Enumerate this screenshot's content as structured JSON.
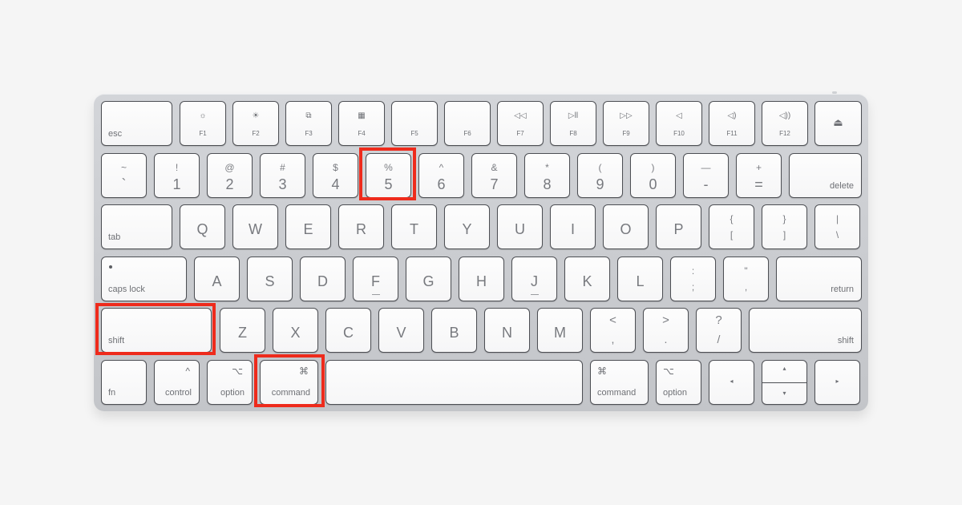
{
  "highlight_color": "#ee2b1c",
  "highlighted_keys": [
    "5",
    "shift-left",
    "command-left"
  ],
  "rows": {
    "function": {
      "esc": "esc",
      "f_keys": [
        {
          "label": "F1",
          "icon": "☼"
        },
        {
          "label": "F2",
          "icon": "☀"
        },
        {
          "label": "F3",
          "icon": "⧉"
        },
        {
          "label": "F4",
          "icon": "▦"
        },
        {
          "label": "F5",
          "icon": ""
        },
        {
          "label": "F6",
          "icon": ""
        },
        {
          "label": "F7",
          "icon": "◁◁"
        },
        {
          "label": "F8",
          "icon": "▷ll"
        },
        {
          "label": "F9",
          "icon": "▷▷"
        },
        {
          "label": "F10",
          "icon": "◁"
        },
        {
          "label": "F11",
          "icon": "◁)"
        },
        {
          "label": "F12",
          "icon": "◁))"
        }
      ],
      "eject_icon": "⏏"
    },
    "number": {
      "keys": [
        {
          "top": "~",
          "bottom": "`"
        },
        {
          "top": "!",
          "bottom": "1"
        },
        {
          "top": "@",
          "bottom": "2"
        },
        {
          "top": "#",
          "bottom": "3"
        },
        {
          "top": "$",
          "bottom": "4"
        },
        {
          "top": "%",
          "bottom": "5"
        },
        {
          "top": "^",
          "bottom": "6"
        },
        {
          "top": "&",
          "bottom": "7"
        },
        {
          "top": "*",
          "bottom": "8"
        },
        {
          "top": "(",
          "bottom": "9"
        },
        {
          "top": ")",
          "bottom": "0"
        },
        {
          "top": "—",
          "bottom": "-"
        },
        {
          "top": "+",
          "bottom": "="
        }
      ],
      "delete": "delete"
    },
    "qwerty": {
      "tab": "tab",
      "letters": [
        "Q",
        "W",
        "E",
        "R",
        "T",
        "Y",
        "U",
        "I",
        "O",
        "P"
      ],
      "brackets": [
        {
          "top": "{",
          "bottom": "["
        },
        {
          "top": "}",
          "bottom": "]"
        },
        {
          "top": "|",
          "bottom": "\\"
        }
      ]
    },
    "home": {
      "caps_lock": "caps lock",
      "letters": [
        "A",
        "S",
        "D",
        "F",
        "G",
        "H",
        "J",
        "K",
        "L"
      ],
      "punct": [
        {
          "top": ":",
          "bottom": ";"
        },
        {
          "top": "\"",
          "bottom": ","
        }
      ],
      "return": "return"
    },
    "bottom_letters": {
      "shift_left": "shift",
      "letters": [
        "Z",
        "X",
        "C",
        "V",
        "B",
        "N",
        "M"
      ],
      "punct": [
        {
          "top": "<",
          "bottom": ","
        },
        {
          "top": ">",
          "bottom": "."
        },
        {
          "top": "?",
          "bottom": "/"
        }
      ],
      "shift_right": "shift"
    },
    "modifiers": {
      "fn": "fn",
      "control": "control",
      "control_icon": "^",
      "option": "option",
      "option_icon": "⌥",
      "command": "command",
      "command_icon": "⌘",
      "arrow_left": "◂",
      "arrow_up": "▴",
      "arrow_down": "▾",
      "arrow_right": "▸"
    }
  }
}
